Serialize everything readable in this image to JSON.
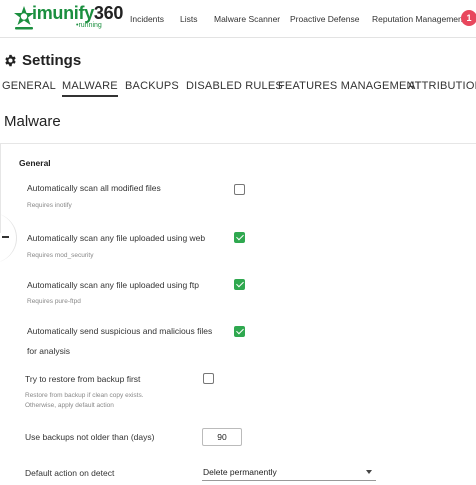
{
  "app": {
    "logo_brand": "imunify",
    "logo_number": "360",
    "logo_status": "•running",
    "brand_color": "#1b8f3f",
    "accent_green": "#2fa84f"
  },
  "nav": {
    "items": [
      "Incidents",
      "Lists",
      "Malware Scanner",
      "Proactive Defense",
      "Reputation Management"
    ],
    "notification_count": "1"
  },
  "settings": {
    "title": "Settings",
    "icon": "gear-icon"
  },
  "tabs": {
    "items": [
      "GENERAL",
      "MALWARE",
      "BACKUPS",
      "DISABLED RULES",
      "FEATURES MANAGEMENT",
      "ATTRIBUTIONS"
    ],
    "active": "MALWARE"
  },
  "section": {
    "title": "Malware"
  },
  "general": {
    "title": "General",
    "options": [
      {
        "label": "Automatically scan all modified files",
        "hint": "Requires inotify",
        "checked": false
      },
      {
        "label": "Automatically scan any file uploaded using web",
        "hint": "Requires mod_security",
        "checked": true
      },
      {
        "label": "Automatically scan any file uploaded using ftp",
        "hint": "Requires pure-ftpd",
        "checked": true
      },
      {
        "label_line1": "Automatically send suspicious and malicious files",
        "label_line2": "for analysis",
        "checked": true
      }
    ]
  },
  "backup": {
    "restore_label": "Try to restore from backup first",
    "restore_hint_line1": "Restore from backup if clean copy exists.",
    "restore_hint_line2": "Otherwise, apply default action",
    "restore_checked": false,
    "age_label": "Use backups not older than (days)",
    "age_value": "90"
  },
  "action": {
    "label": "Default action on detect",
    "selected": "Delete permanently"
  }
}
